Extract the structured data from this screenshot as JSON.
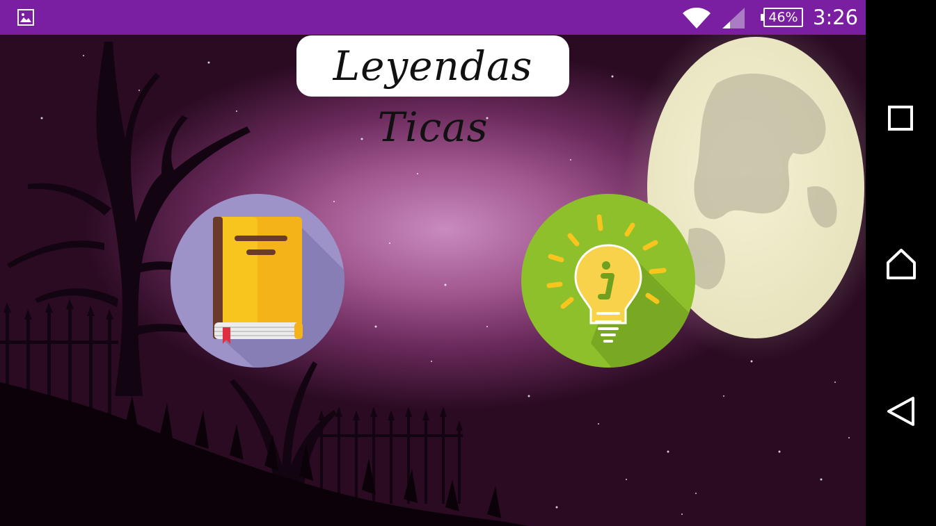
{
  "status_bar": {
    "battery_level": "46%",
    "time": "3:26",
    "colors": {
      "background": "#7b1fa2"
    }
  },
  "app": {
    "title": "Leyendas Ticas"
  },
  "main": {
    "buttons": [
      {
        "icon": "book-icon",
        "color": "#9d93c8"
      },
      {
        "icon": "lightbulb-icon",
        "color": "#8dc02a"
      }
    ]
  },
  "nav_bar": {
    "icons": [
      "recents-square-icon",
      "home-icon",
      "back-triangle-icon"
    ]
  }
}
